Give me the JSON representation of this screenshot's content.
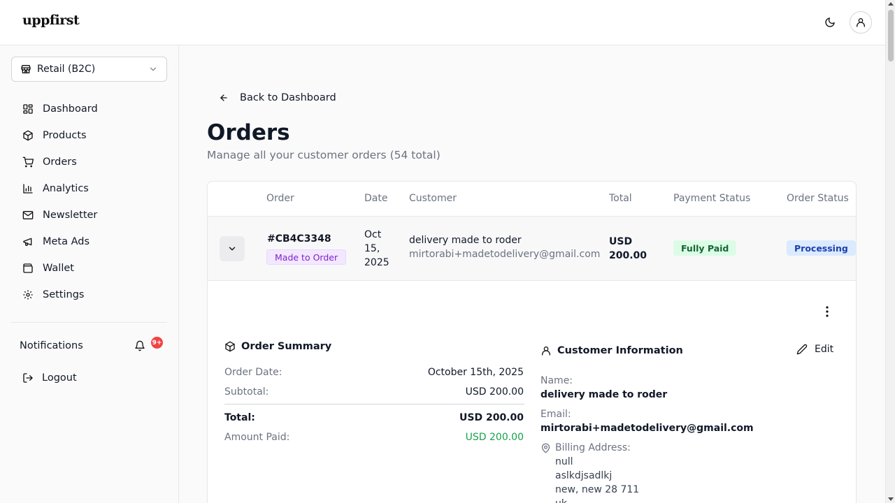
{
  "app": {
    "logo": "uppfirst"
  },
  "header": {
    "theme_icon": "moon-icon",
    "user_icon": "user-icon"
  },
  "sidebar": {
    "store": {
      "label": "Retail (B2C)",
      "icon": "store-icon"
    },
    "items": [
      {
        "label": "Dashboard",
        "icon": "grid-icon"
      },
      {
        "label": "Products",
        "icon": "package-icon"
      },
      {
        "label": "Orders",
        "icon": "cart-icon"
      },
      {
        "label": "Analytics",
        "icon": "bar-chart-icon"
      },
      {
        "label": "Newsletter",
        "icon": "mail-icon"
      },
      {
        "label": "Meta Ads",
        "icon": "megaphone-icon"
      },
      {
        "label": "Wallet",
        "icon": "wallet-icon"
      },
      {
        "label": "Settings",
        "icon": "gear-icon"
      }
    ],
    "notifications": {
      "label": "Notifications",
      "badge": "9+"
    },
    "logout": {
      "label": "Logout"
    }
  },
  "main": {
    "back_label": "Back to Dashboard",
    "title": "Orders",
    "subtitle": "Manage all your customer orders (54 total)",
    "table": {
      "headers": {
        "order": "Order",
        "date": "Date",
        "customer": "Customer",
        "total": "Total",
        "payment": "Payment Status",
        "status": "Order Status"
      },
      "row": {
        "id": "#CB4C3348",
        "type_badge": "Made to Order",
        "date": "Oct 15, 2025",
        "customer_name": "delivery made to roder",
        "customer_email": "mirtorabi+madetodelivery@gmail.com",
        "total": "USD 200.00",
        "payment_status": "Fully Paid",
        "order_status": "Processing"
      }
    },
    "order_summary": {
      "title": "Order Summary",
      "order_date_label": "Order Date:",
      "order_date": "October 15th, 2025",
      "subtotal_label": "Subtotal:",
      "subtotal": "USD 200.00",
      "total_label": "Total:",
      "total": "USD 200.00",
      "paid_label": "Amount Paid:",
      "paid": "USD 200.00"
    },
    "customer_info": {
      "title": "Customer Information",
      "edit_label": "Edit",
      "name_label": "Name:",
      "name": "delivery made to roder",
      "email_label": "Email:",
      "email": "mirtorabi+madetodelivery@gmail.com",
      "billing_label": "Billing Address:",
      "billing_lines": [
        "null",
        "aslkdjsadlkj",
        "new, new 28 711",
        "uk"
      ]
    }
  },
  "colors": {
    "accent_green": "#16a34a",
    "badge_red": "#ef4444",
    "purple_badge": "#7e22ce",
    "blue_badge": "#1e40af"
  }
}
